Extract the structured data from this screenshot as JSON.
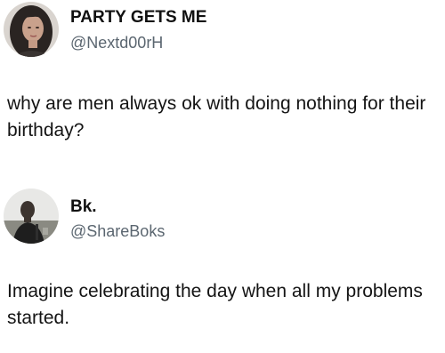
{
  "tweets": [
    {
      "author": {
        "display_name": "PARTY GETS ME",
        "handle": "@Nextd00rH",
        "avatar_icon": "woman-portrait-avatar"
      },
      "text": "why are men always ok with doing nothing for their birthday?"
    },
    {
      "author": {
        "display_name": "Bk.",
        "handle": "@ShareBoks",
        "avatar_icon": "man-portrait-avatar"
      },
      "text": "Imagine celebrating the day when all my problems started."
    }
  ]
}
